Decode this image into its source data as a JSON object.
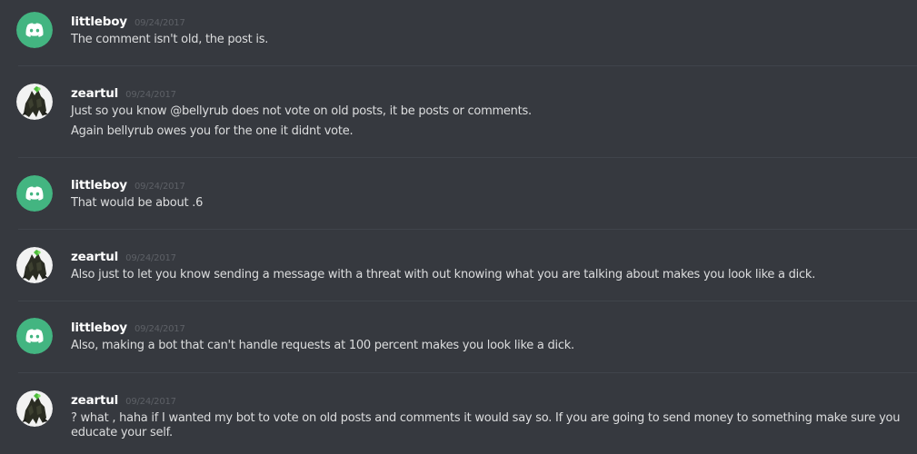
{
  "colors": {
    "background": "#36393f",
    "discord_avatar": "#43b581",
    "username": "#ffffff",
    "timestamp": "#5d6066",
    "message_text": "#dcddde",
    "divider": "#40444b"
  },
  "messages": [
    {
      "author": "littleboy",
      "avatar_icon": "discord-logo-icon",
      "timestamp": "09/24/2017",
      "lines": [
        "The comment isn't old, the post is."
      ]
    },
    {
      "author": "zeartul",
      "avatar_icon": "dark-creature-avatar-icon",
      "timestamp": "09/24/2017",
      "lines": [
        "Just so you know @bellyrub does not vote on old posts, it be posts or comments.",
        "Again bellyrub owes you for the one it didnt vote."
      ]
    },
    {
      "author": "littleboy",
      "avatar_icon": "discord-logo-icon",
      "timestamp": "09/24/2017",
      "lines": [
        "That would be about .6"
      ]
    },
    {
      "author": "zeartul",
      "avatar_icon": "dark-creature-avatar-icon",
      "timestamp": "09/24/2017",
      "lines": [
        "Also just to let you know sending a message with a threat with out knowing what you are talking about makes you look like a dick."
      ]
    },
    {
      "author": "littleboy",
      "avatar_icon": "discord-logo-icon",
      "timestamp": "09/24/2017",
      "lines": [
        "Also, making a bot that can't handle requests at 100 percent makes you look like a dick."
      ]
    },
    {
      "author": "zeartul",
      "avatar_icon": "dark-creature-avatar-icon",
      "timestamp": "09/24/2017",
      "lines": [
        "? what , haha if I wanted my bot to vote on old posts and comments it would say so. If you are going to send money to something make sure you educate your self."
      ]
    }
  ]
}
